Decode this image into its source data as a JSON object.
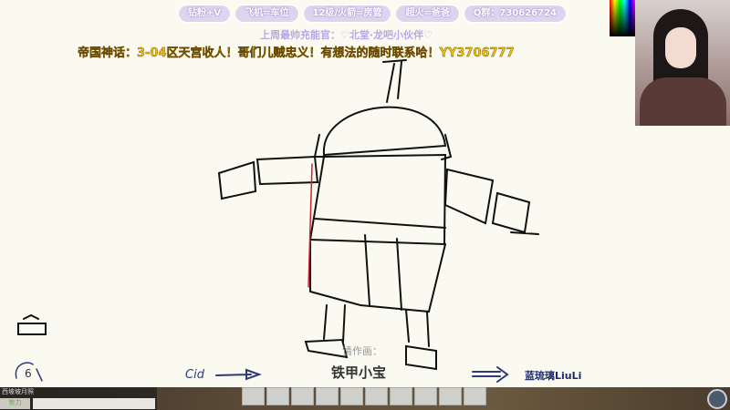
{
  "overlay": {
    "tags": [
      "钻粉+V",
      "飞机=车位",
      "12级/火箭=房管",
      "超火=爸爸",
      "Q群：730626724"
    ],
    "weekly": "上周最帅充能官：♡北堂·龙吧小伙伴♡",
    "ad": "帝国神话：3-04区天宫收人！哥们儿贼忠义！有想法的随时联系哈！YY3706777"
  },
  "drawing": {
    "prompt": "请作画：",
    "word": "铁甲小宝",
    "from": "Cid",
    "to": "蓝琉璃LiuLi",
    "countdown": "6"
  },
  "game": {
    "chat_name": "西坡坡月照",
    "chat_tab": "势力"
  },
  "colors": {
    "ad": "#f3c20c",
    "tag": "#d2c8eb",
    "stroke": "#111111",
    "accent_line": "#d0202a"
  }
}
